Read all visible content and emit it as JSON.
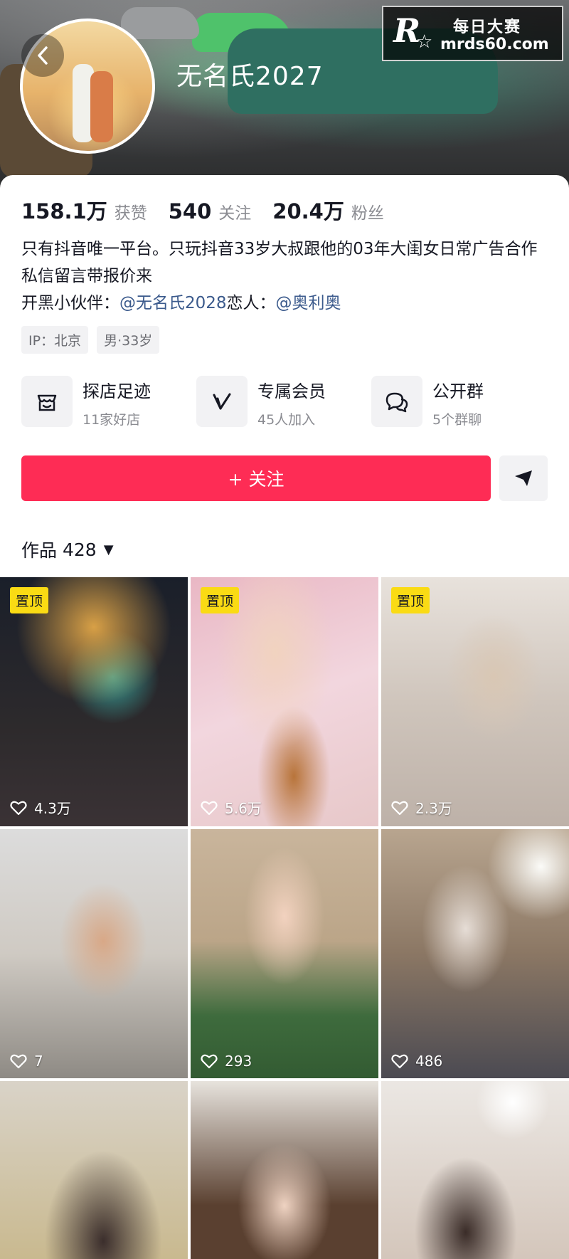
{
  "header": {
    "nickname": "无名氏2027",
    "watermark": {
      "brand_cn": "每日大赛",
      "brand_url": "mrds60.com"
    }
  },
  "stats": [
    {
      "value": "158.1万",
      "label": "获赞"
    },
    {
      "value": "540",
      "label": "关注"
    },
    {
      "value": "20.4万",
      "label": "粉丝"
    }
  ],
  "bio": {
    "line1": "只有抖音唯一平台。只玩抖音33岁大叔跟他的03年大闺女日常广告合作私信留言带报价来",
    "partner_label": "开黑小伙伴：",
    "partner_handle": "@无名氏2028",
    "lover_label": "恋人：",
    "lover_handle": "@奥利奥"
  },
  "tags": [
    "IP：北京",
    "男·33岁"
  ],
  "features": [
    {
      "title": "探店足迹",
      "sub": "11家好店",
      "icon": "shop-icon"
    },
    {
      "title": "专属会员",
      "sub": "45人加入",
      "icon": "vip-icon"
    },
    {
      "title": "公开群",
      "sub": "5个群聊",
      "icon": "group-chat-icon"
    }
  ],
  "follow_button": "+ 关注",
  "works": {
    "label": "作品",
    "count": "428"
  },
  "videos": [
    {
      "pinned": "置顶",
      "likes": "4.3万"
    },
    {
      "pinned": "置顶",
      "likes": "5.6万"
    },
    {
      "pinned": "置顶",
      "likes": "2.3万"
    },
    {
      "pinned": "",
      "likes": "7"
    },
    {
      "pinned": "",
      "likes": "293"
    },
    {
      "pinned": "",
      "likes": "486"
    },
    {
      "pinned": "",
      "likes": ""
    },
    {
      "pinned": "",
      "likes": ""
    },
    {
      "pinned": "",
      "likes": ""
    }
  ],
  "colors": {
    "accent": "#fe2c55",
    "pin_badge": "#fadb14",
    "mention": "#3b5a8c"
  }
}
